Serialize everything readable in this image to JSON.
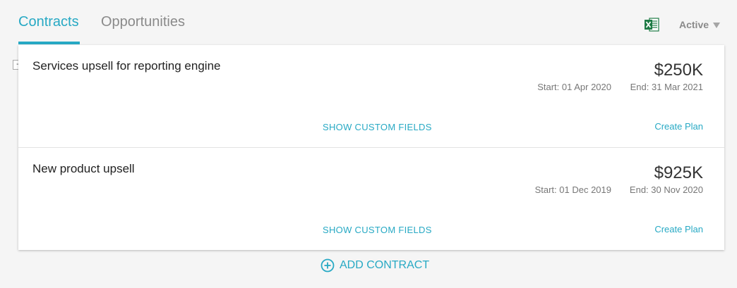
{
  "tabs": {
    "contracts": "Contracts",
    "opportunities": "Opportunities"
  },
  "header": {
    "status_filter": "Active",
    "accent_color": "#27a9c4",
    "excel_icon": "excel-export-icon"
  },
  "contracts": [
    {
      "name": "Services upsell for reporting engine",
      "value": "$250K",
      "start": "Start: 01 Apr 2020",
      "end": "End: 31 Mar 2021",
      "show_custom_fields": "SHOW CUSTOM FIELDS",
      "create_plan": "Create Plan"
    },
    {
      "name": "New product upsell",
      "value": "$925K",
      "start": "Start: 01 Dec 2019",
      "end": "End: 30 Nov 2020",
      "show_custom_fields": "SHOW CUSTOM FIELDS",
      "create_plan": "Create Plan"
    }
  ],
  "collapse_toggle": "-",
  "add_contract": "ADD CONTRACT"
}
